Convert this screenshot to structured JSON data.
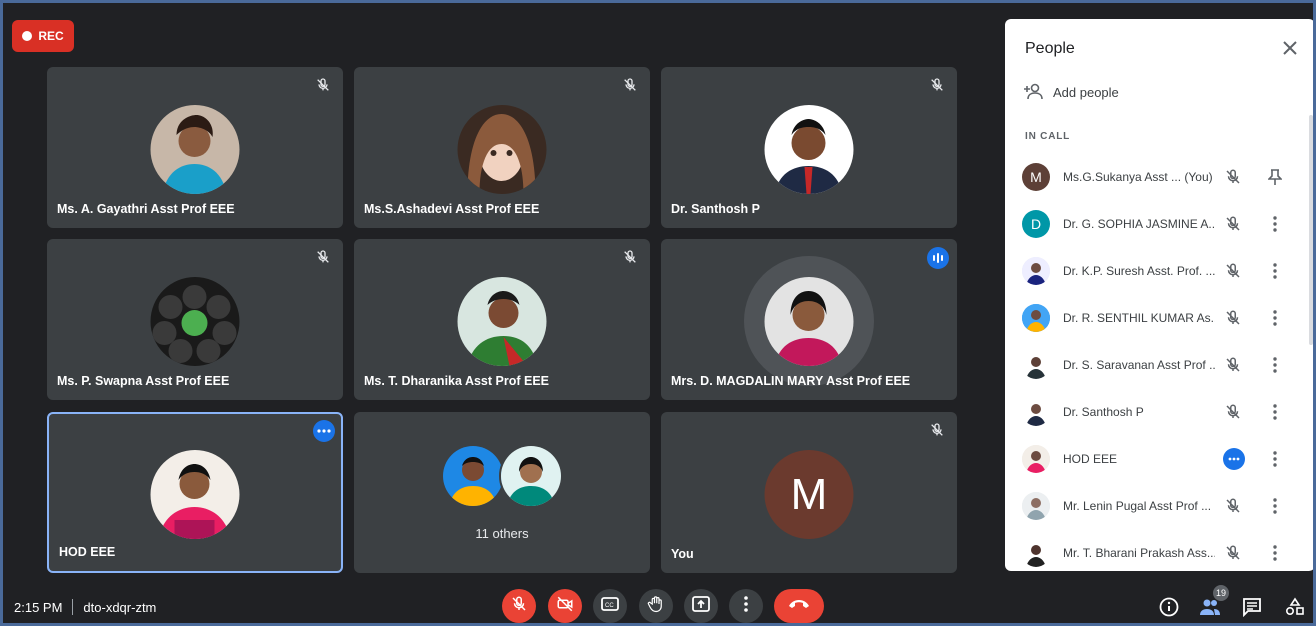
{
  "recording": {
    "label": "REC"
  },
  "tiles": [
    {
      "name": "Ms. A. Gayathri Asst Prof EEE"
    },
    {
      "name": "Ms.S.Ashadevi Asst Prof EEE"
    },
    {
      "name": "Dr. Santhosh P"
    },
    {
      "name": "Ms. P. Swapna Asst Prof EEE"
    },
    {
      "name": "Ms. T. Dharanika Asst Prof EEE"
    },
    {
      "name": "Mrs. D. MAGDALIN MARY Asst Prof EEE"
    },
    {
      "name": "HOD EEE"
    },
    {
      "others_label": "11 others"
    },
    {
      "name": "You",
      "initial": "M"
    }
  ],
  "panel": {
    "title": "People",
    "add_people": "Add people",
    "section": "IN CALL",
    "participants": [
      {
        "name": "Ms.G.Sukanya Asst ...",
        "you": "(You)",
        "initial": "M",
        "color": "#5d4037"
      },
      {
        "name": "Dr. G. SOPHIA JASMINE A...",
        "initial": "D",
        "color": "#0097a7"
      },
      {
        "name": "Dr. K.P. Suresh Asst. Prof. ..."
      },
      {
        "name": "Dr. R. SENTHIL KUMAR As..."
      },
      {
        "name": "Dr. S. Saravanan Asst Prof ..."
      },
      {
        "name": "Dr. Santhosh P"
      },
      {
        "name": "HOD EEE"
      },
      {
        "name": "Mr. Lenin Pugal Asst Prof ..."
      },
      {
        "name": "Mr. T. Bharani Prakash Ass..."
      }
    ]
  },
  "footer": {
    "time": "2:15 PM",
    "meeting_code": "dto-xdqr-ztm",
    "people_count": "19"
  }
}
